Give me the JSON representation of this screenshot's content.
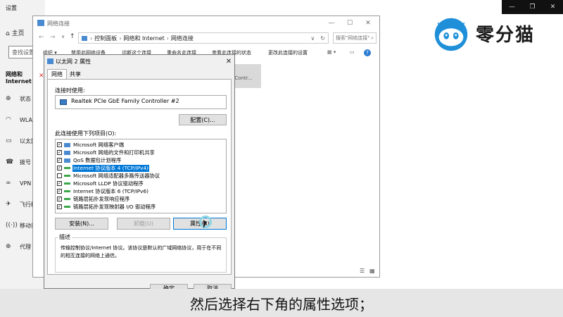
{
  "settings": {
    "title": "设置",
    "home": "主页",
    "search_value": "查找设置",
    "section": "网络和 Internet",
    "nav": [
      {
        "icon": "globe-icon",
        "glyph": "⊕",
        "label": "状态"
      },
      {
        "icon": "wifi-icon",
        "glyph": "◠",
        "label": "WLAN"
      },
      {
        "icon": "ethernet-icon",
        "glyph": "▭",
        "label": "以太网"
      },
      {
        "icon": "dialup-icon",
        "glyph": "☎",
        "label": "拨号"
      },
      {
        "icon": "vpn-icon",
        "glyph": "∞",
        "label": "VPN"
      },
      {
        "icon": "airplane-icon",
        "glyph": "✈",
        "label": "飞行模式"
      },
      {
        "icon": "hotspot-icon",
        "glyph": "((·))",
        "label": "移动热点"
      },
      {
        "icon": "proxy-icon",
        "glyph": "⊕",
        "label": "代理"
      }
    ]
  },
  "explorer": {
    "title": "网络连接",
    "breadcrumb": [
      "控制面板",
      "网络和 Internet",
      "网络连接"
    ],
    "search_placeholder": "搜索\"网络连接\"",
    "toolbar": [
      "组织 ▾",
      "禁用此网络设备",
      "诊断这个连接",
      "重命名此连接",
      "查看此连接的状态",
      "更改此连接的设置"
    ],
    "adapter_tile_text": "ly Contr..."
  },
  "dialog": {
    "title": "以太网 2 属性",
    "tabs": [
      "网络",
      "共享"
    ],
    "connect_using_label": "连接时使用:",
    "adapter_name": "Realtek PCIe GbE Family Controller #2",
    "configure_button": "配置(C)...",
    "items_label": "此连接使用下列项目(O):",
    "items": [
      {
        "label": "Microsoft 网络客户端",
        "checked": true,
        "icon": "blue",
        "selected": false
      },
      {
        "label": "Microsoft 网络的文件和打印机共享",
        "checked": true,
        "icon": "blue",
        "selected": false
      },
      {
        "label": "QoS 数据包计划程序",
        "checked": true,
        "icon": "blue",
        "selected": false
      },
      {
        "label": "Internet 协议版本 4 (TCP/IPv4)",
        "checked": true,
        "icon": "green",
        "selected": true
      },
      {
        "label": "Microsoft 网络适配器多路传送器协议",
        "checked": false,
        "icon": "green",
        "selected": false
      },
      {
        "label": "Microsoft LLDP 协议驱动程序",
        "checked": true,
        "icon": "green",
        "selected": false
      },
      {
        "label": "Internet 协议版本 6 (TCP/IPv6)",
        "checked": true,
        "icon": "green",
        "selected": false
      },
      {
        "label": "链路层拓扑发现响应程序",
        "checked": true,
        "icon": "green",
        "selected": false
      },
      {
        "label": "链路层拓扑发现映射器 I/O 驱动程序",
        "checked": true,
        "icon": "green",
        "selected": false
      }
    ],
    "install_button": "安装(N)...",
    "uninstall_button": "卸载(U)",
    "properties_button": "属性(R)",
    "description_legend": "描述",
    "description_text": "传输控制协议/Internet 协议。该协议是默认的广域网络协议，用于在不同的相互连接的网络上通信。",
    "ok_button": "确定",
    "cancel_button": "取消"
  },
  "watermark": {
    "brand": "零分猫"
  },
  "subtitle": "然后选择右下角的属性选项；"
}
